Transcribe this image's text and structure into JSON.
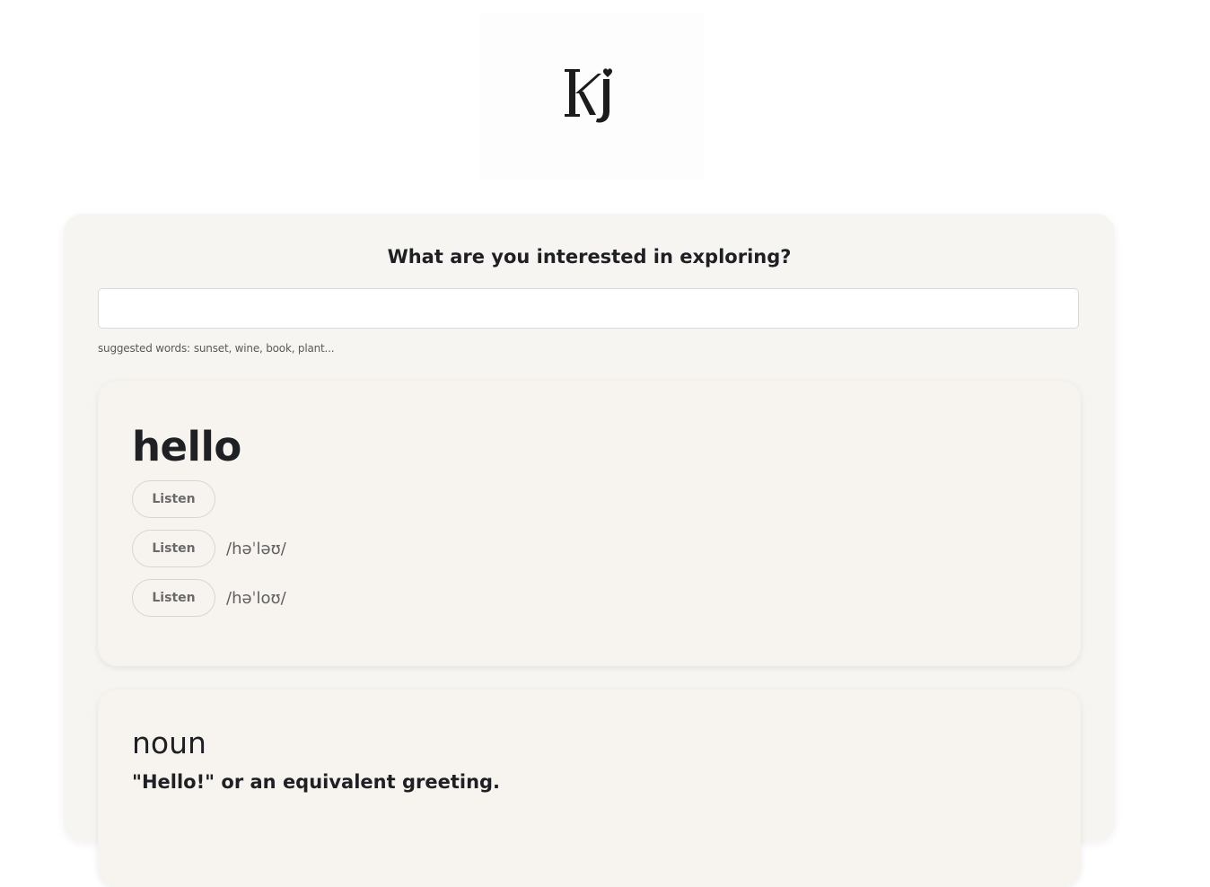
{
  "logo": {
    "icon": "kj-monogram-heart-logo",
    "text": "KJ"
  },
  "prompt": "What are you interested in exploring?",
  "search": {
    "value": "",
    "placeholder": ""
  },
  "suggested": {
    "label": "suggested words:",
    "words": "sunset, wine, book, plant..."
  },
  "entry": {
    "word": "hello",
    "pronunciations": [
      {
        "button_label": "Listen",
        "phonetic": ""
      },
      {
        "button_label": "Listen",
        "phonetic": "/həˈləʊ/"
      },
      {
        "button_label": "Listen",
        "phonetic": "/həˈloʊ/"
      }
    ]
  },
  "meanings": [
    {
      "part_of_speech": "noun",
      "definition": "\"Hello!\" or an equivalent greeting."
    }
  ]
}
